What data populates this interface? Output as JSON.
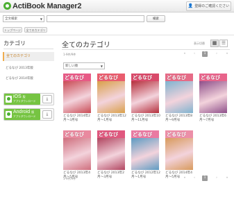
{
  "header": {
    "logo_text": "ActiBook Manager2",
    "user_button": "登録のご確認ください",
    "user_icon": "person-icon"
  },
  "search": {
    "scope_selected": "全文検索",
    "input_value": "",
    "button_label": "検索"
  },
  "tabs": [
    {
      "label": "トップページ"
    },
    {
      "label": "全てのカテゴリ"
    }
  ],
  "sidebar": {
    "title": "カテゴリ",
    "items": [
      {
        "label": "全てのカテゴリ",
        "active": true
      },
      {
        "label": "どるなび 2013年版"
      },
      {
        "label": "どるなび 2014年版"
      }
    ],
    "apps": [
      {
        "platform": "iOS",
        "suffix": "版",
        "subtitle": "アプリダウンロード",
        "icon": "download-icon"
      },
      {
        "platform": "Android",
        "suffix": "版",
        "subtitle": "アプリダウンロード",
        "icon": "download-icon"
      }
    ]
  },
  "main": {
    "title": "全てのカテゴリ",
    "sort_label": "表示切替",
    "view_grid_icon": "grid-view-icon",
    "view_list_icon": "list-view-icon",
    "count_text": "1-9件/9件",
    "sort_select": "新しい順",
    "pager": {
      "first": "«",
      "prev": "‹",
      "current": "1",
      "next": "›",
      "last": "»"
    },
    "books": [
      {
        "brand": "どるなび",
        "caption": "どるなび 2014年2月～3月号",
        "color": "#e85a86",
        "photo": "#c94b55"
      },
      {
        "brand": "どるなび",
        "caption": "どるなび 2013年12月～1月号",
        "color": "#e95d6e",
        "photo": "#d9a04a"
      },
      {
        "brand": "どるなび",
        "caption": "どるなび 2013年10月～11月号",
        "color": "#d94a6a",
        "photo": "#b52f3c"
      },
      {
        "brand": "どるなび",
        "caption": "どるなび 2013年8月～9月号",
        "color": "#e66b87",
        "photo": "#7fb3cf"
      },
      {
        "brand": "どるなび",
        "caption": "どるなび 2013年6月～7月号",
        "color": "#e8648b",
        "photo": "#8e4f8a"
      },
      {
        "brand": "どるなび",
        "caption": "どるなび 2013年4月～5月号",
        "color": "#e9899f",
        "photo": "#cf6f7e"
      },
      {
        "brand": "どるなび",
        "caption": "どるなび 2013年2月～3月号",
        "color": "#e0577e",
        "photo": "#b14560"
      },
      {
        "brand": "どるなび",
        "caption": "どるなび 2012年12月～1月号",
        "color": "#ea7aa2",
        "photo": "#5d9bc2"
      },
      {
        "brand": "どるなび",
        "caption": "どるなび 2014年4月～5月号",
        "color": "#ec8fa8",
        "photo": "#d89a5c"
      }
    ],
    "bottom_count_text": "1-9件/9件"
  }
}
